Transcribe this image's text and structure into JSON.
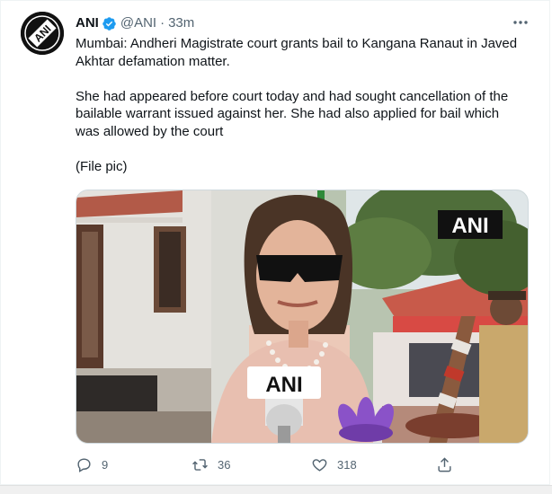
{
  "tweet": {
    "author_name": "ANI",
    "handle": "@ANI",
    "separator": "·",
    "time": "33m",
    "paragraphs": [
      "Mumbai: Andheri Magistrate court grants bail to Kangana Ranaut in Javed Akhtar defamation matter.",
      "She had appeared before court today and had sought cancellation of the bailable warrant issued against her. She had also applied for bail which was allowed by the court",
      "(File pic)"
    ]
  },
  "avatar": {
    "logo_text": "ANI"
  },
  "media": {
    "watermark": "ANI",
    "mic_label": "ANI"
  },
  "actions": {
    "reply_count": "9",
    "retweet_count": "36",
    "like_count": "318"
  },
  "icons": {
    "verified": "verified-badge-icon",
    "more": "more-options-icon",
    "reply": "reply-icon",
    "retweet": "retweet-icon",
    "like": "heart-icon",
    "share": "share-icon"
  },
  "colors": {
    "verified_blue": "#1d9bf0",
    "secondary_text": "#536471",
    "primary_text": "#0f1419"
  }
}
